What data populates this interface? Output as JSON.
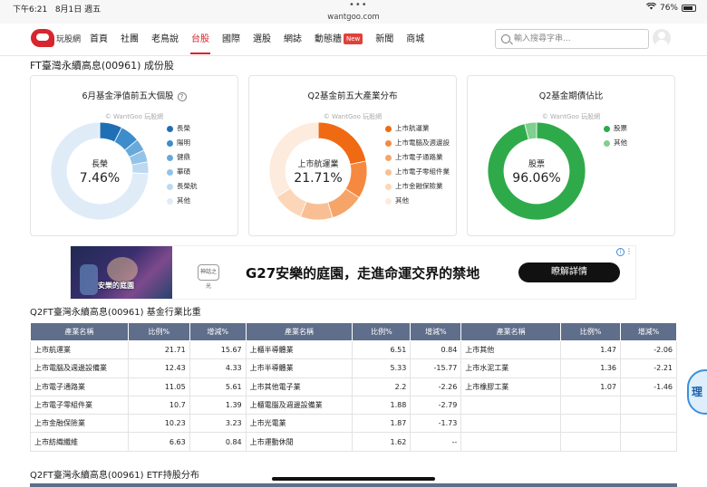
{
  "status_bar": {
    "time": "下午6:21",
    "date": "8月1日 週五",
    "url": "wantgoo.com",
    "battery": "76%"
  },
  "brand": {
    "logo_text": "玩股網"
  },
  "nav": {
    "items": [
      {
        "label": "首頁"
      },
      {
        "label": "社團"
      },
      {
        "label": "老鳥說"
      },
      {
        "label": "台股",
        "active": true
      },
      {
        "label": "國際"
      },
      {
        "label": "選股"
      },
      {
        "label": "網誌"
      },
      {
        "label": "動態牆",
        "badge": "New"
      },
      {
        "label": "新聞"
      },
      {
        "label": "商城"
      }
    ],
    "search_placeholder": "輸入搜尋字串..."
  },
  "page": {
    "title": "FT臺灣永續高息(00961) 成份股"
  },
  "cards": [
    {
      "title": "6月基金淨值前五大個股",
      "watermark": "© WantGoo 玩股網",
      "center_label": "長榮",
      "center_value": "7.46%",
      "legend": [
        {
          "label": "長榮",
          "color": "#1f6fb5"
        },
        {
          "label": "陽明",
          "color": "#3d8ccb"
        },
        {
          "label": "健鼎",
          "color": "#67a9db"
        },
        {
          "label": "華碩",
          "color": "#93c3e8"
        },
        {
          "label": "長榮航",
          "color": "#bcd9f1"
        },
        {
          "label": "其他",
          "color": "#dfecf8"
        }
      ]
    },
    {
      "title": "Q2基金前五大產業分布",
      "watermark": "© WantGoo 玩股網",
      "center_label": "上市航運業",
      "center_value": "21.71%",
      "legend": [
        {
          "label": "上市航運業",
          "color": "#f06a14"
        },
        {
          "label": "上市電腦及週邊設",
          "color": "#f5893f"
        },
        {
          "label": "上市電子通路業",
          "color": "#f7a468"
        },
        {
          "label": "上市電子零組件業",
          "color": "#f9bf94"
        },
        {
          "label": "上市金融保險業",
          "color": "#fbd6b8"
        },
        {
          "label": "其他",
          "color": "#fdebdd"
        }
      ]
    },
    {
      "title": "Q2基金期債佔比",
      "watermark": "© WantGoo 玩股網",
      "center_label": "股票",
      "center_value": "96.06%",
      "legend": [
        {
          "label": "股票",
          "color": "#2faa4a"
        },
        {
          "label": "其他",
          "color": "#7fcf8e"
        }
      ]
    }
  ],
  "chart_data": [
    {
      "type": "pie",
      "categories": [
        "長榮",
        "陽明",
        "健鼎",
        "華碩",
        "長榮航",
        "其他"
      ],
      "values": [
        7.46,
        6.5,
        4.0,
        4.0,
        3.9,
        74.14
      ]
    },
    {
      "type": "pie",
      "categories": [
        "上市航運業",
        "上市電腦及週邊設",
        "上市電子通路業",
        "上市電子零組件業",
        "上市金融保險業",
        "其他"
      ],
      "values": [
        21.71,
        12.43,
        11.05,
        10.7,
        10.23,
        33.88
      ]
    },
    {
      "type": "pie",
      "categories": [
        "股票",
        "其他"
      ],
      "values": [
        96.06,
        3.94
      ]
    }
  ],
  "ad": {
    "image_text": "安樂的庭園",
    "logo": "神話之光",
    "text": "G27安樂的庭園，走進命運交界的禁地",
    "button": "瞭解詳情",
    "info": "i",
    "more": "⋮"
  },
  "industry": {
    "title": "Q2FT臺灣永續高息(00961) 基金行業比重",
    "headers": [
      "產業名稱",
      "比例%",
      "增減%",
      "產業名稱",
      "比例%",
      "增減%",
      "產業名稱",
      "比例%",
      "增減%"
    ],
    "rows": [
      [
        [
          "上市航運業",
          "21.71",
          "15.67"
        ],
        [
          "上櫃半導體業",
          "6.51",
          "0.84"
        ],
        [
          "上市其他",
          "1.47",
          "-2.06"
        ]
      ],
      [
        [
          "上市電腦及週邊設備業",
          "12.43",
          "4.33"
        ],
        [
          "上市半導體業",
          "5.33",
          "-15.77"
        ],
        [
          "上市水泥工業",
          "1.36",
          "-2.21"
        ]
      ],
      [
        [
          "上市電子通路業",
          "11.05",
          "5.61"
        ],
        [
          "上市其他電子業",
          "2.2",
          "-2.26"
        ],
        [
          "上市橡膠工業",
          "1.07",
          "-1.46"
        ]
      ],
      [
        [
          "上市電子零組件業",
          "10.7",
          "1.39"
        ],
        [
          "上櫃電腦及週邊設備業",
          "1.88",
          "-2.79"
        ],
        [
          "",
          "",
          ""
        ]
      ],
      [
        [
          "上市金融保險業",
          "10.23",
          "3.23"
        ],
        [
          "上市光電業",
          "1.87",
          "-1.73"
        ],
        [
          "",
          "",
          ""
        ]
      ],
      [
        [
          "上市紡織纖維",
          "6.63",
          "0.84"
        ],
        [
          "上市運動休閒",
          "1.62",
          "--"
        ],
        [
          "",
          "",
          ""
        ]
      ]
    ]
  },
  "etf_section": {
    "title": "Q2FT臺灣永續高息(00961) ETF持股分布"
  },
  "float_button": {
    "label": "理"
  }
}
